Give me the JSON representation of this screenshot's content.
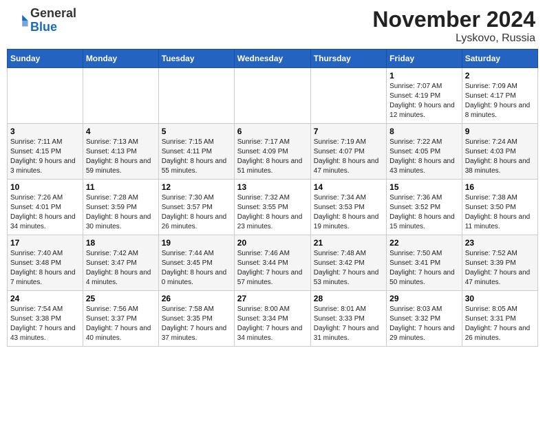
{
  "header": {
    "logo": {
      "general": "General",
      "blue": "Blue"
    },
    "title": "November 2024",
    "location": "Lyskovo, Russia"
  },
  "days_of_week": [
    "Sunday",
    "Monday",
    "Tuesday",
    "Wednesday",
    "Thursday",
    "Friday",
    "Saturday"
  ],
  "weeks": [
    {
      "days": [
        {
          "num": "",
          "info": ""
        },
        {
          "num": "",
          "info": ""
        },
        {
          "num": "",
          "info": ""
        },
        {
          "num": "",
          "info": ""
        },
        {
          "num": "",
          "info": ""
        },
        {
          "num": "1",
          "info": "Sunrise: 7:07 AM\nSunset: 4:19 PM\nDaylight: 9 hours and 12 minutes."
        },
        {
          "num": "2",
          "info": "Sunrise: 7:09 AM\nSunset: 4:17 PM\nDaylight: 9 hours and 8 minutes."
        }
      ]
    },
    {
      "days": [
        {
          "num": "3",
          "info": "Sunrise: 7:11 AM\nSunset: 4:15 PM\nDaylight: 9 hours and 3 minutes."
        },
        {
          "num": "4",
          "info": "Sunrise: 7:13 AM\nSunset: 4:13 PM\nDaylight: 8 hours and 59 minutes."
        },
        {
          "num": "5",
          "info": "Sunrise: 7:15 AM\nSunset: 4:11 PM\nDaylight: 8 hours and 55 minutes."
        },
        {
          "num": "6",
          "info": "Sunrise: 7:17 AM\nSunset: 4:09 PM\nDaylight: 8 hours and 51 minutes."
        },
        {
          "num": "7",
          "info": "Sunrise: 7:19 AM\nSunset: 4:07 PM\nDaylight: 8 hours and 47 minutes."
        },
        {
          "num": "8",
          "info": "Sunrise: 7:22 AM\nSunset: 4:05 PM\nDaylight: 8 hours and 43 minutes."
        },
        {
          "num": "9",
          "info": "Sunrise: 7:24 AM\nSunset: 4:03 PM\nDaylight: 8 hours and 38 minutes."
        }
      ]
    },
    {
      "days": [
        {
          "num": "10",
          "info": "Sunrise: 7:26 AM\nSunset: 4:01 PM\nDaylight: 8 hours and 34 minutes."
        },
        {
          "num": "11",
          "info": "Sunrise: 7:28 AM\nSunset: 3:59 PM\nDaylight: 8 hours and 30 minutes."
        },
        {
          "num": "12",
          "info": "Sunrise: 7:30 AM\nSunset: 3:57 PM\nDaylight: 8 hours and 26 minutes."
        },
        {
          "num": "13",
          "info": "Sunrise: 7:32 AM\nSunset: 3:55 PM\nDaylight: 8 hours and 23 minutes."
        },
        {
          "num": "14",
          "info": "Sunrise: 7:34 AM\nSunset: 3:53 PM\nDaylight: 8 hours and 19 minutes."
        },
        {
          "num": "15",
          "info": "Sunrise: 7:36 AM\nSunset: 3:52 PM\nDaylight: 8 hours and 15 minutes."
        },
        {
          "num": "16",
          "info": "Sunrise: 7:38 AM\nSunset: 3:50 PM\nDaylight: 8 hours and 11 minutes."
        }
      ]
    },
    {
      "days": [
        {
          "num": "17",
          "info": "Sunrise: 7:40 AM\nSunset: 3:48 PM\nDaylight: 8 hours and 7 minutes."
        },
        {
          "num": "18",
          "info": "Sunrise: 7:42 AM\nSunset: 3:47 PM\nDaylight: 8 hours and 4 minutes."
        },
        {
          "num": "19",
          "info": "Sunrise: 7:44 AM\nSunset: 3:45 PM\nDaylight: 8 hours and 0 minutes."
        },
        {
          "num": "20",
          "info": "Sunrise: 7:46 AM\nSunset: 3:44 PM\nDaylight: 7 hours and 57 minutes."
        },
        {
          "num": "21",
          "info": "Sunrise: 7:48 AM\nSunset: 3:42 PM\nDaylight: 7 hours and 53 minutes."
        },
        {
          "num": "22",
          "info": "Sunrise: 7:50 AM\nSunset: 3:41 PM\nDaylight: 7 hours and 50 minutes."
        },
        {
          "num": "23",
          "info": "Sunrise: 7:52 AM\nSunset: 3:39 PM\nDaylight: 7 hours and 47 minutes."
        }
      ]
    },
    {
      "days": [
        {
          "num": "24",
          "info": "Sunrise: 7:54 AM\nSunset: 3:38 PM\nDaylight: 7 hours and 43 minutes."
        },
        {
          "num": "25",
          "info": "Sunrise: 7:56 AM\nSunset: 3:37 PM\nDaylight: 7 hours and 40 minutes."
        },
        {
          "num": "26",
          "info": "Sunrise: 7:58 AM\nSunset: 3:35 PM\nDaylight: 7 hours and 37 minutes."
        },
        {
          "num": "27",
          "info": "Sunrise: 8:00 AM\nSunset: 3:34 PM\nDaylight: 7 hours and 34 minutes."
        },
        {
          "num": "28",
          "info": "Sunrise: 8:01 AM\nSunset: 3:33 PM\nDaylight: 7 hours and 31 minutes."
        },
        {
          "num": "29",
          "info": "Sunrise: 8:03 AM\nSunset: 3:32 PM\nDaylight: 7 hours and 29 minutes."
        },
        {
          "num": "30",
          "info": "Sunrise: 8:05 AM\nSunset: 3:31 PM\nDaylight: 7 hours and 26 minutes."
        }
      ]
    }
  ]
}
